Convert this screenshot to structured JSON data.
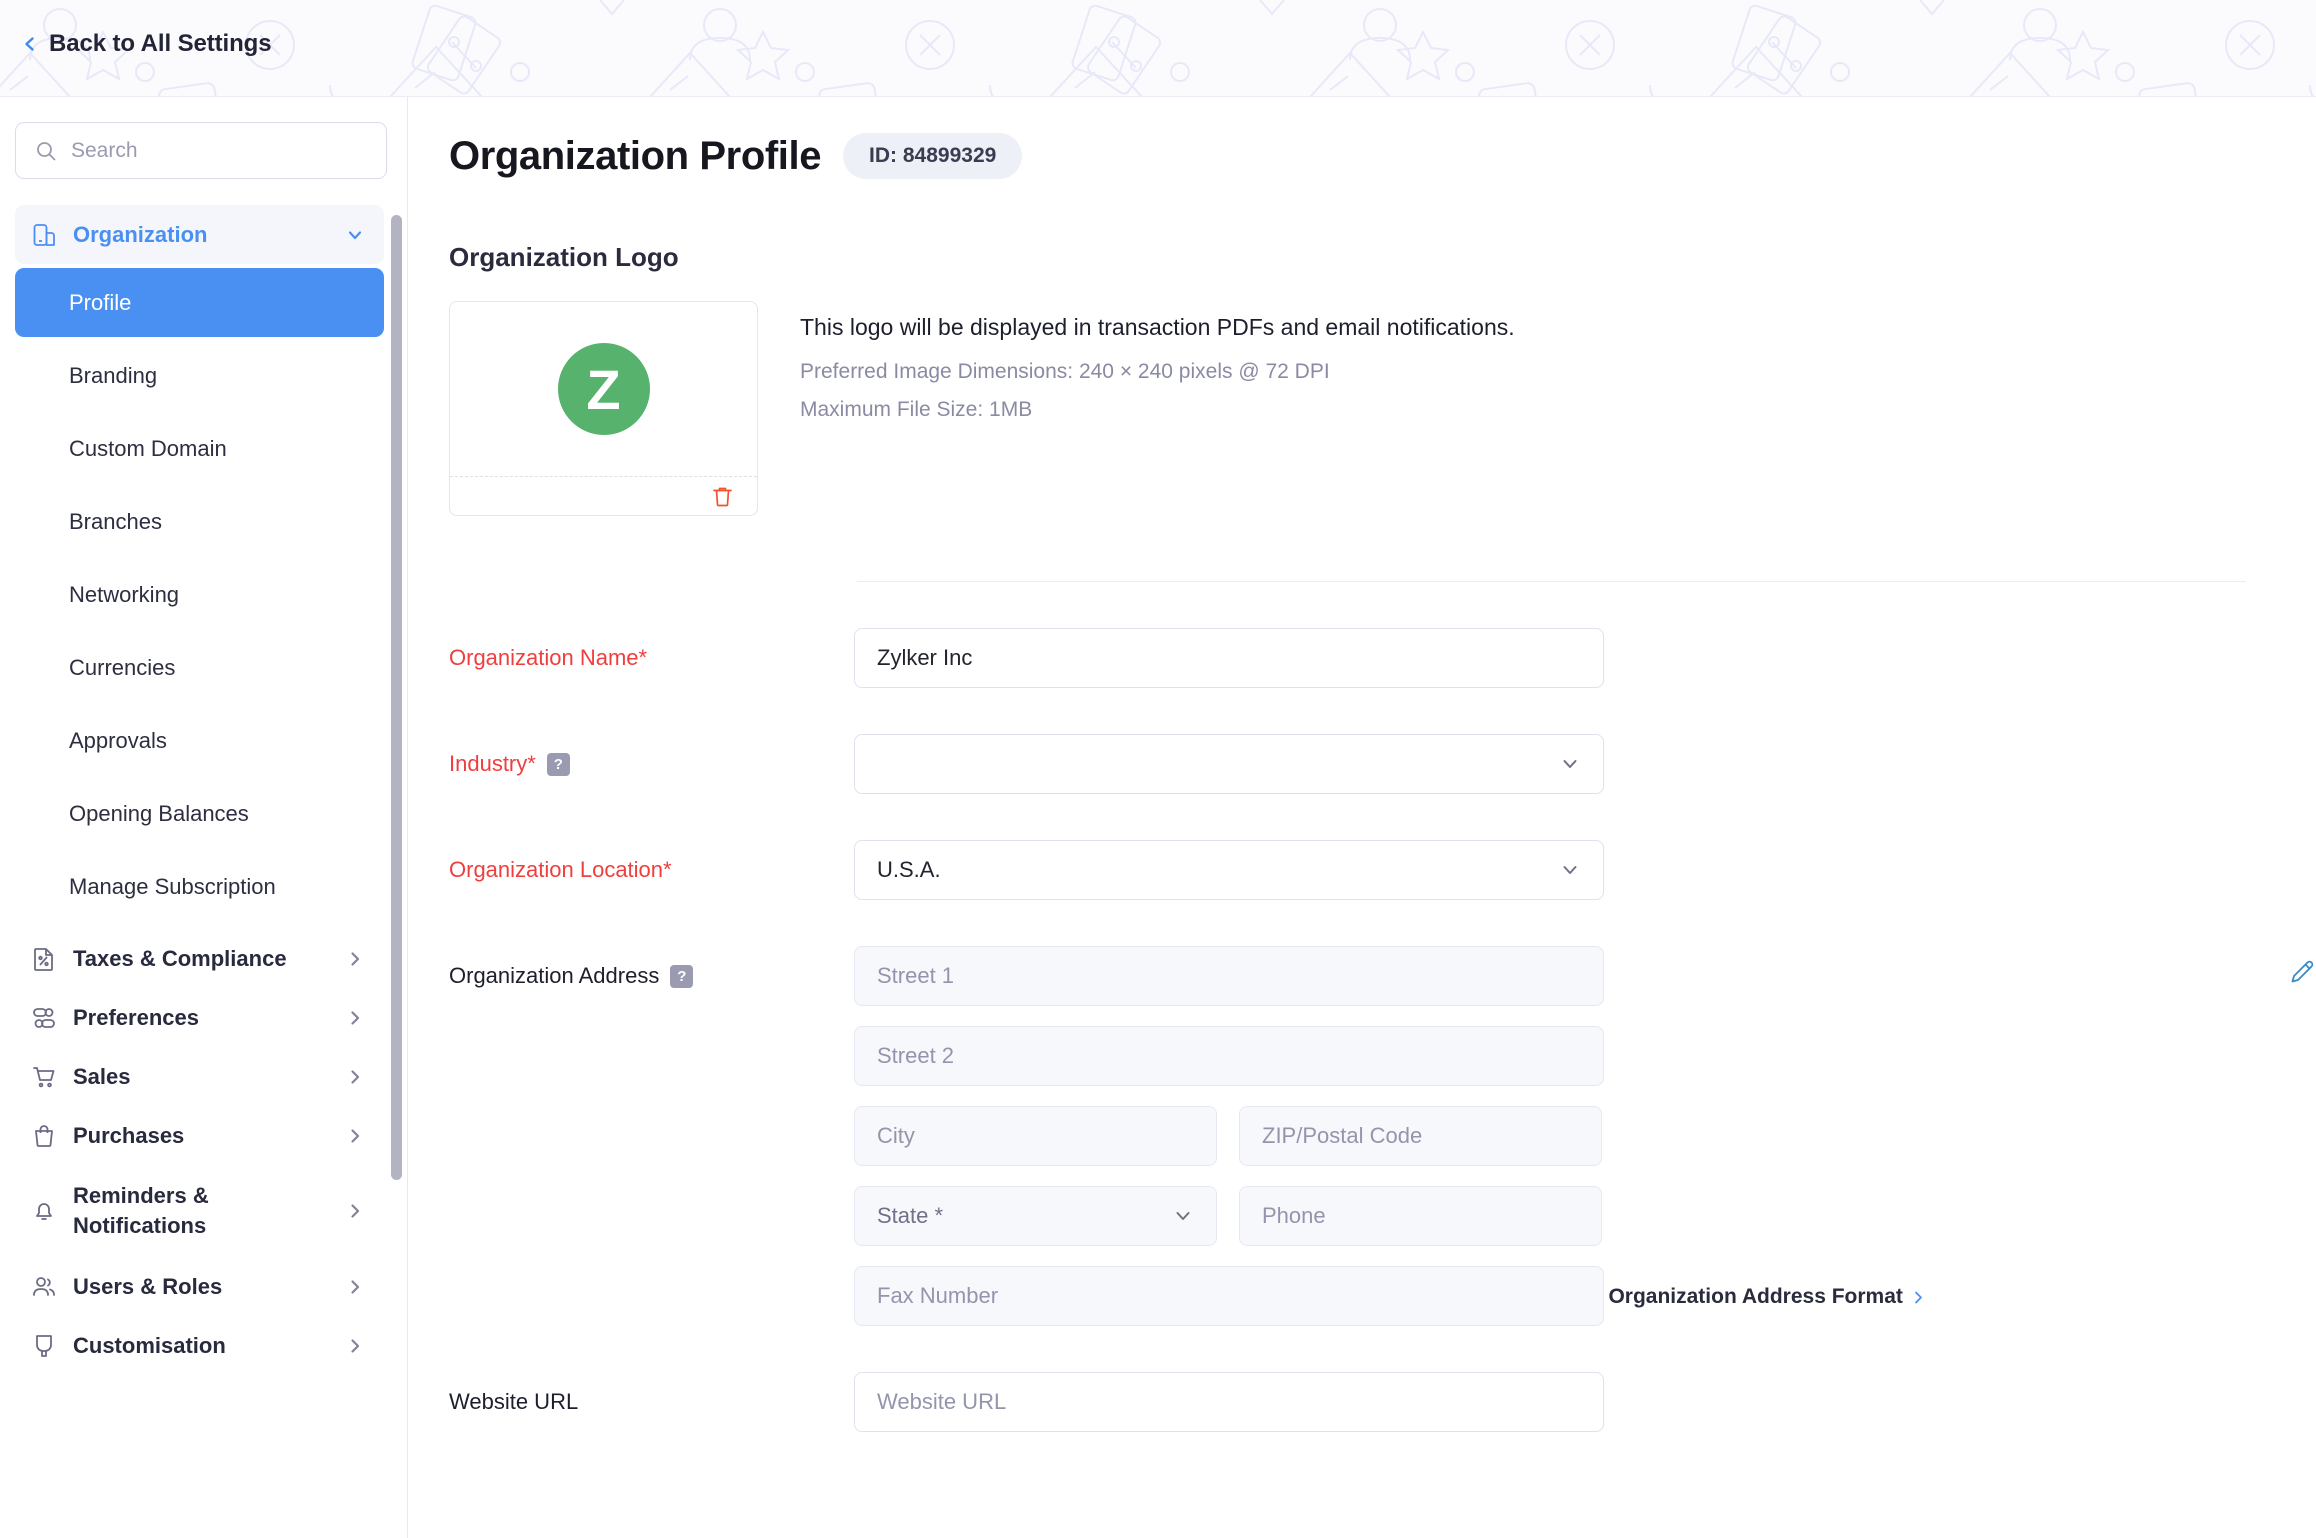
{
  "topbar": {
    "back_label": "Back to All Settings",
    "back_icon": "chevron-left-icon"
  },
  "search": {
    "placeholder": "Search",
    "value": "",
    "icon": "search-icon"
  },
  "sidebar": {
    "groups": [
      {
        "label": "Organization",
        "icon": "organization-icon",
        "chevron": "chevron-down-icon",
        "expanded": true,
        "items": [
          {
            "label": "Profile",
            "active": true
          },
          {
            "label": "Branding",
            "active": false
          },
          {
            "label": "Custom Domain",
            "active": false
          },
          {
            "label": "Branches",
            "active": false
          },
          {
            "label": "Networking",
            "active": false
          },
          {
            "label": "Currencies",
            "active": false
          },
          {
            "label": "Approvals",
            "active": false
          },
          {
            "label": "Opening Balances",
            "active": false
          },
          {
            "label": "Manage Subscription",
            "active": false
          }
        ]
      },
      {
        "label": "Taxes & Compliance",
        "icon": "tax-document-icon",
        "chevron": "chevron-right-icon",
        "expanded": false
      },
      {
        "label": "Preferences",
        "icon": "preferences-icon",
        "chevron": "chevron-right-icon",
        "expanded": false
      },
      {
        "label": "Sales",
        "icon": "shopping-cart-icon",
        "chevron": "chevron-right-icon",
        "expanded": false
      },
      {
        "label": "Purchases",
        "icon": "shopping-bag-icon",
        "chevron": "chevron-right-icon",
        "expanded": false
      },
      {
        "label": "Reminders & Notifications",
        "icon": "bell-icon",
        "chevron": "chevron-right-icon",
        "expanded": false
      },
      {
        "label": "Users & Roles",
        "icon": "users-icon",
        "chevron": "chevron-right-icon",
        "expanded": false
      },
      {
        "label": "Customisation",
        "icon": "customisation-icon",
        "chevron": "chevron-right-icon",
        "expanded": false
      }
    ]
  },
  "main": {
    "page_title": "Organization Profile",
    "id_badge": "ID: 84899329",
    "logo_section": {
      "title": "Organization Logo",
      "logo_letter": "Z",
      "logo_color": "#56b26c",
      "delete_icon": "trash-icon",
      "description": "This logo will be displayed in transaction PDFs and email notifications.",
      "preferred_dimensions": "Preferred Image Dimensions: 240 × 240 pixels @ 72 DPI",
      "max_file_size": "Maximum File Size: 1MB"
    },
    "form": {
      "org_name": {
        "label": "Organization Name*",
        "value": "Zylker Inc",
        "placeholder": ""
      },
      "industry": {
        "label": "Industry*",
        "help": "?",
        "value": "",
        "placeholder": ""
      },
      "org_location": {
        "label": "Organization Location*",
        "value": "U.S.A."
      },
      "org_address": {
        "label": "Organization Address",
        "help": "?",
        "edit_icon": "pencil-icon",
        "street1_placeholder": "Street 1",
        "street2_placeholder": "Street 2",
        "city_placeholder": "City",
        "zip_placeholder": "ZIP/Postal Code",
        "state_value": "State *",
        "phone_placeholder": "Phone",
        "fax_placeholder": "Fax Number",
        "format_link": "Organization Address Format"
      },
      "website": {
        "label": "Website URL",
        "placeholder": "Website URL",
        "value": ""
      }
    }
  },
  "colors": {
    "accent_blue": "#4a90f2",
    "required_red": "#f03e3e",
    "logo_green": "#56b26c",
    "delete_red": "#f2512c",
    "badge_bg": "#eef0f8"
  }
}
